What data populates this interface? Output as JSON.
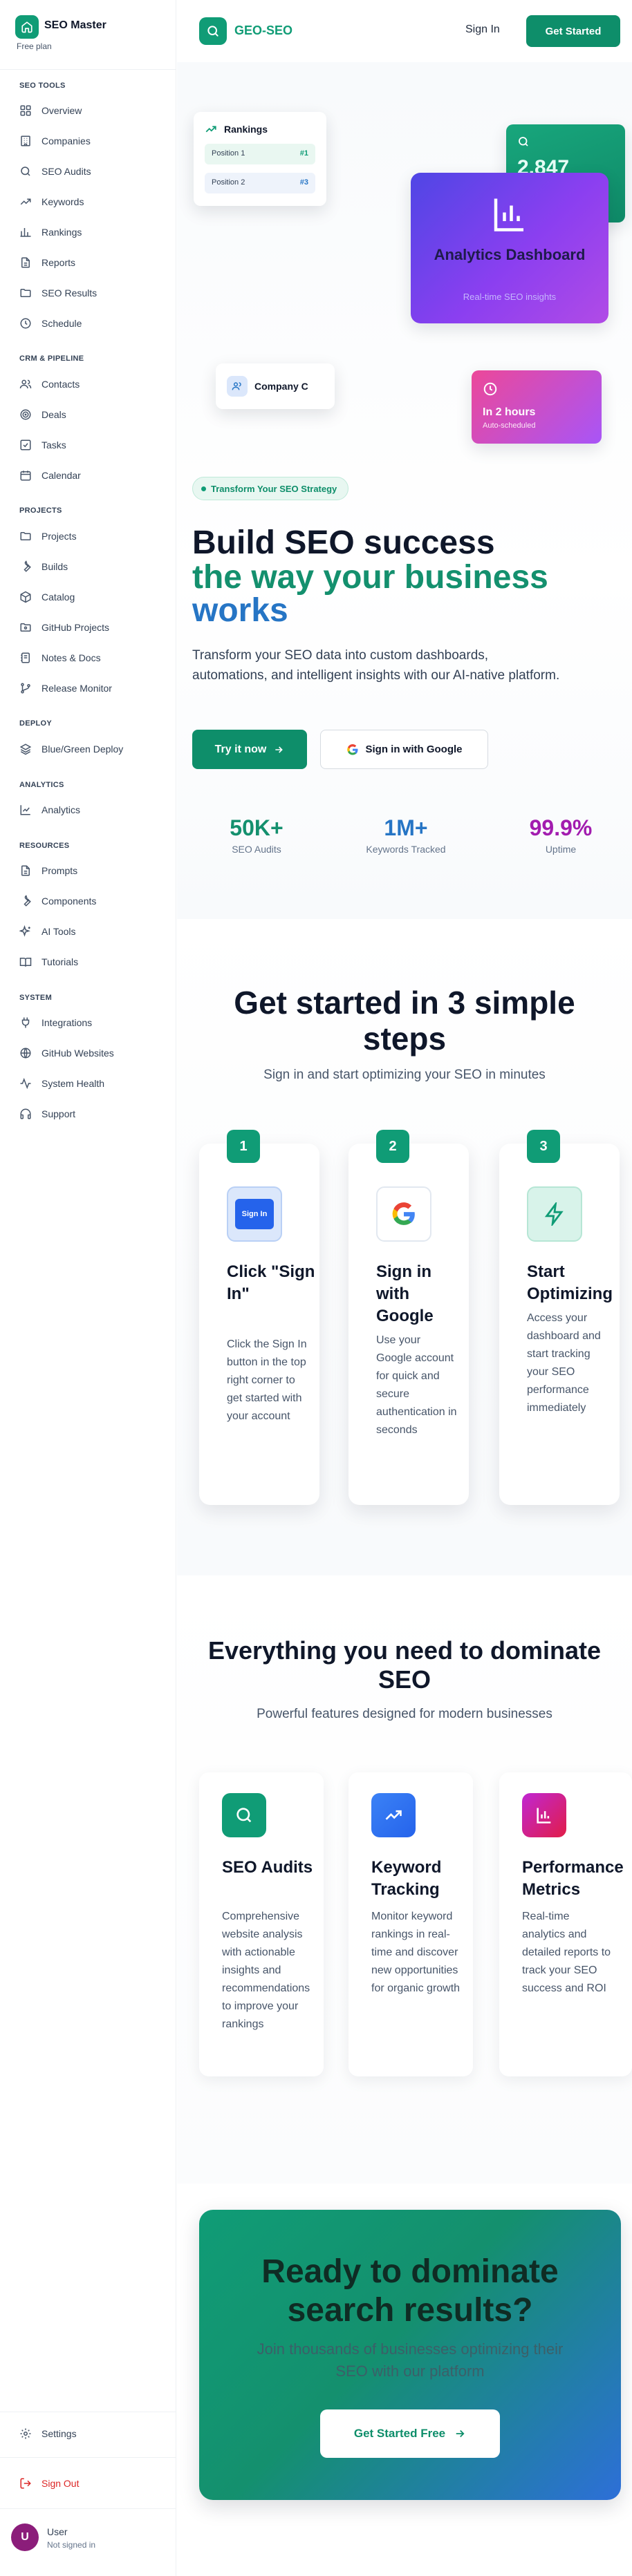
{
  "sidebar": {
    "brand": {
      "name": "SEO Master",
      "plan": "Free plan"
    },
    "sections": [
      {
        "title": "SEO TOOLS",
        "items": [
          "Overview",
          "Companies",
          "SEO Audits",
          "Keywords",
          "Rankings",
          "Reports",
          "SEO Results",
          "Schedule"
        ]
      },
      {
        "title": "CRM & PIPELINE",
        "items": [
          "Contacts",
          "Deals",
          "Tasks",
          "Calendar"
        ]
      },
      {
        "title": "PROJECTS",
        "items": [
          "Projects",
          "Builds",
          "Catalog",
          "GitHub Projects",
          "Notes & Docs",
          "Release Monitor"
        ]
      },
      {
        "title": "DEPLOY",
        "items": [
          "Blue/Green Deploy"
        ]
      },
      {
        "title": "ANALYTICS",
        "items": [
          "Analytics"
        ]
      },
      {
        "title": "RESOURCES",
        "items": [
          "Prompts",
          "Components",
          "AI Tools",
          "Tutorials"
        ]
      },
      {
        "title": "SYSTEM",
        "items": [
          "Integrations",
          "GitHub Websites",
          "System Health",
          "Support"
        ]
      }
    ],
    "settings": "Settings",
    "sign_out": "Sign Out",
    "user": {
      "initial": "U",
      "name": "User",
      "status": "Not signed in"
    }
  },
  "header": {
    "logo_text": "GEO-SEO",
    "sign_in": "Sign In",
    "get_started": "Get Started"
  },
  "hero": {
    "rankings_card": {
      "title": "Rankings",
      "rows": [
        {
          "label": "Position 1",
          "rank": "#1"
        },
        {
          "label": "Position 2",
          "rank": "#3"
        }
      ]
    },
    "stat_card_value": "2,847",
    "analytics_card": {
      "title": "Analytics Dashboard",
      "subtitle": "Real-time SEO insights"
    },
    "company_card": "Company C",
    "schedule_card": {
      "title": "In 2 hours",
      "subtitle": "Auto-scheduled"
    },
    "badge": "Transform Your SEO Strategy",
    "title_line1": "Build SEO success",
    "title_line2": "the way your business",
    "title_line3": "works",
    "lead": "Transform your SEO data into custom dashboards, automations, and intelligent insights with our AI-native platform.",
    "try_button": "Try it now",
    "google_button": "Sign in with Google",
    "stats": [
      {
        "value": "50K+",
        "label": "SEO Audits",
        "color": "#14906e"
      },
      {
        "value": "1M+",
        "label": "Keywords Tracked",
        "color": "#2675c5"
      },
      {
        "value": "99.9%",
        "label": "Uptime",
        "color": "#a21caf"
      }
    ]
  },
  "steps_section": {
    "title_line1": "Get started in 3 simple",
    "title_line2": "steps",
    "subtitle": "Sign in and start optimizing your SEO in minutes",
    "steps": [
      {
        "num": "1",
        "icon_label": "Sign In",
        "title": "Click \"Sign In\"",
        "desc": "Click the Sign In button in the top right corner to get started with your account"
      },
      {
        "num": "2",
        "title": "Sign in with Google",
        "desc": "Use your Google account for quick and secure authentication in seconds"
      },
      {
        "num": "3",
        "title": "Start Optimizing",
        "desc": "Access your dashboard and start tracking your SEO performance immediately"
      }
    ]
  },
  "features_section": {
    "title_line1": "Everything you need to dominate",
    "title_line2": "SEO",
    "subtitle": "Powerful features designed for modern businesses",
    "features": [
      {
        "title": "SEO Audits",
        "desc": "Comprehensive website analysis with actionable insights and recommendations to improve your rankings"
      },
      {
        "title": "Keyword Tracking",
        "desc": "Monitor keyword rankings in real-time and discover new opportunities for organic growth"
      },
      {
        "title": "Performance Metrics",
        "desc": "Real-time analytics and detailed reports to track your SEO success and ROI"
      }
    ]
  },
  "cta": {
    "title_line1": "Ready to dominate",
    "title_line2": "search results?",
    "subtitle": "Join thousands of businesses optimizing their SEO with our platform",
    "button": "Get Started Free"
  }
}
